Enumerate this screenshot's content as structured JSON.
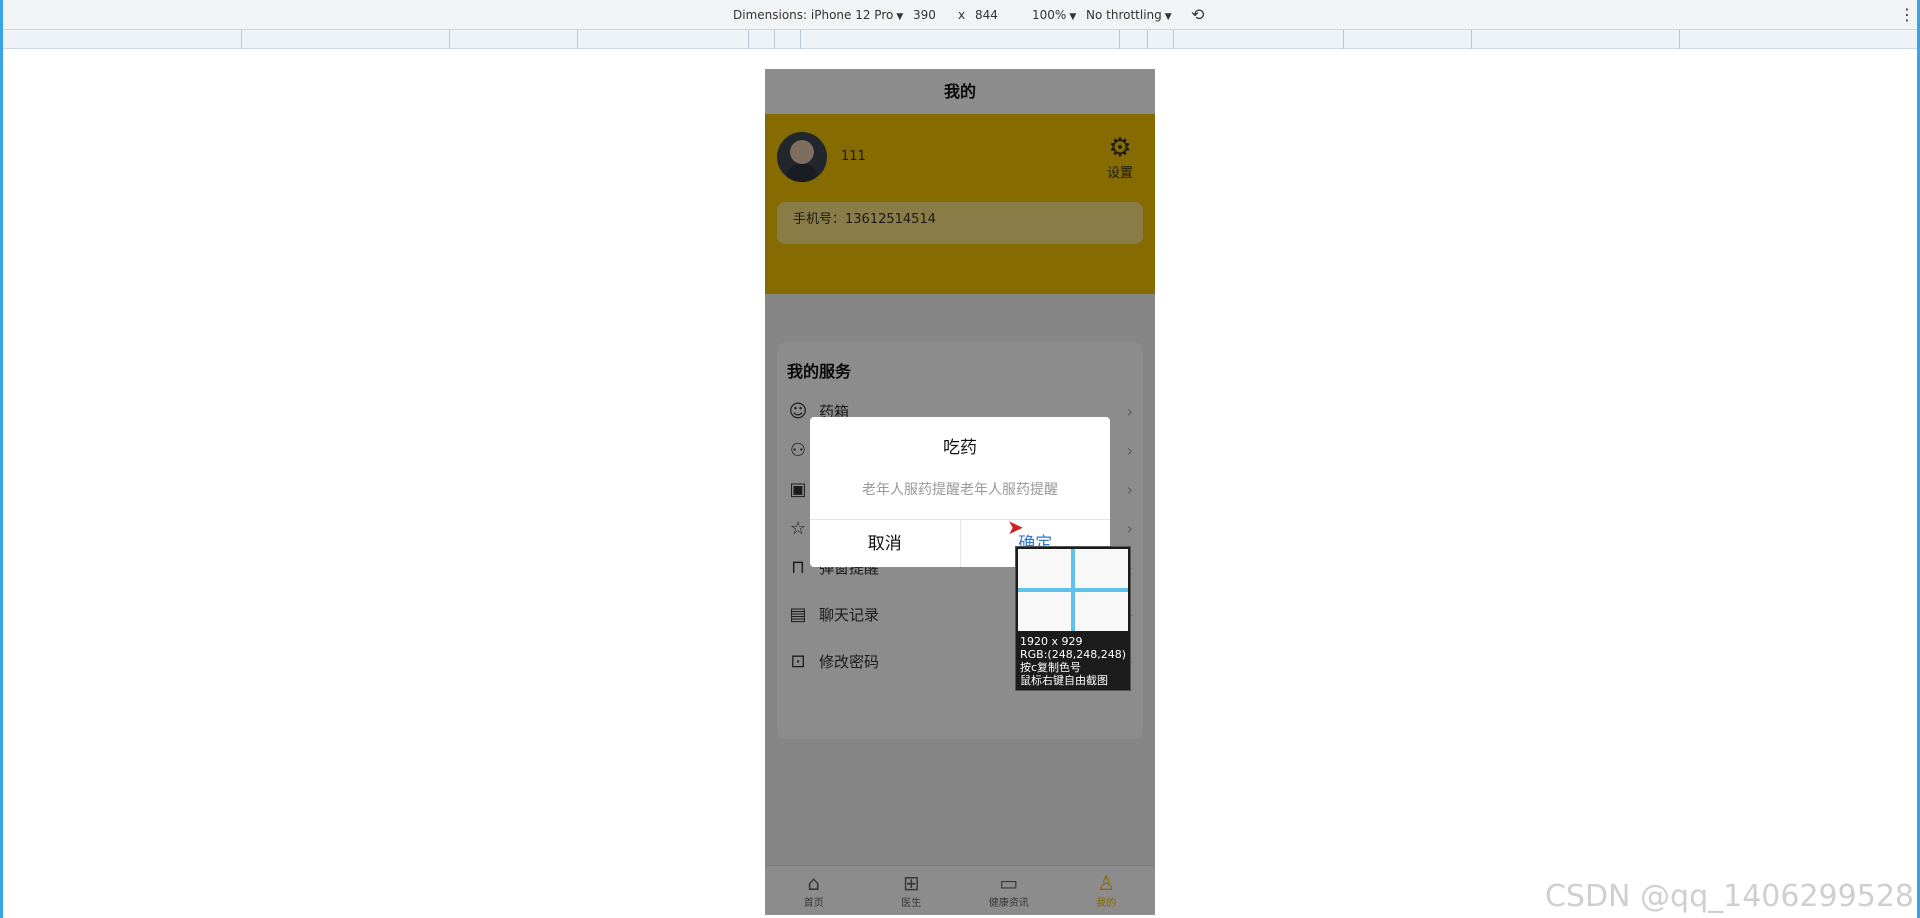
{
  "devtools": {
    "dimensions_label": "Dimensions: iPhone 12 Pro",
    "width_value": "390",
    "times": "x",
    "height_value": "844",
    "zoom": "100%",
    "throttling": "No throttling",
    "rotate_icon": "rotate-icon",
    "more_icon": "more-icon"
  },
  "app": {
    "title": "我的",
    "user": {
      "name": "111",
      "phone_label": "手机号：13612514514"
    },
    "settings_label": "设置",
    "services_title": "我的服务",
    "services": [
      {
        "icon": "emoji-icon",
        "label": "药箱"
      },
      {
        "icon": "group-icon",
        "label": ""
      },
      {
        "icon": "contact-icon",
        "label": ""
      },
      {
        "icon": "star-icon",
        "label": ""
      },
      {
        "icon": "bag-icon",
        "label": "弹窗提醒"
      },
      {
        "icon": "chat-card-icon",
        "label": "聊天记录"
      },
      {
        "icon": "lock-icon",
        "label": "修改密码"
      }
    ],
    "tabs": [
      {
        "icon": "home-icon",
        "label": "首页"
      },
      {
        "icon": "grid-icon",
        "label": "医生"
      },
      {
        "icon": "news-icon",
        "label": "健康资讯"
      },
      {
        "icon": "user-icon",
        "label": "我的"
      }
    ],
    "active_tab": "我的"
  },
  "modal": {
    "title": "吃药",
    "content": "老年人服药提醒老年人服药提醒",
    "cancel": "取消",
    "confirm": "确定"
  },
  "picker": {
    "size": "1920 x 929",
    "rgb": "RGB:(248,248,248)",
    "hint1": "按c复制色号",
    "hint2": "鼠标右键自由截图"
  },
  "watermark": "CSDN @qq_1406299528",
  "colors": {
    "accent": "#f5c400",
    "confirm": "#2f78d5",
    "frame": "#3aa3e3"
  }
}
